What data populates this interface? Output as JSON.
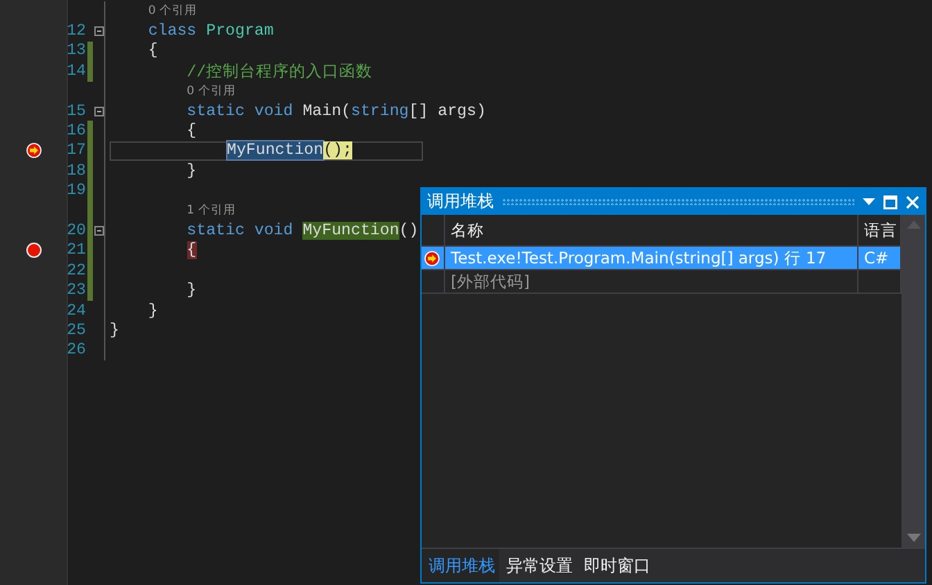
{
  "editor": {
    "lines": [
      {
        "kind": "lens",
        "text": "0 个引用",
        "changed": false
      },
      {
        "kind": "code",
        "number": "12",
        "foldable": true,
        "changed": false,
        "breakpoint": false,
        "current_statement": false,
        "current": false,
        "tokens": [
          {
            "text": "    class",
            "kind": "keyword"
          },
          {
            "text": " Program",
            "kind": "type"
          }
        ]
      },
      {
        "kind": "code",
        "number": "13",
        "foldable": false,
        "changed": true,
        "breakpoint": false,
        "current_statement": false,
        "current": false,
        "tokens": [
          {
            "text": "    {",
            "kind": "plain"
          }
        ]
      },
      {
        "kind": "code",
        "number": "14",
        "foldable": false,
        "changed": true,
        "breakpoint": false,
        "current_statement": false,
        "current": false,
        "tokens": [
          {
            "text": "        //控制台程序的入口函数",
            "kind": "comment"
          }
        ]
      },
      {
        "kind": "lens",
        "text": "0 个引用",
        "changed": false
      },
      {
        "kind": "code",
        "number": "15",
        "foldable": true,
        "changed": false,
        "breakpoint": false,
        "current_statement": false,
        "current": false,
        "tokens": [
          {
            "text": "        static",
            "kind": "keyword"
          },
          {
            "text": " void",
            "kind": "keyword"
          },
          {
            "text": " Main(",
            "kind": "plain"
          },
          {
            "text": "string",
            "kind": "keyword"
          },
          {
            "text": "[] args)",
            "kind": "plain"
          }
        ]
      },
      {
        "kind": "code",
        "number": "16",
        "foldable": false,
        "changed": true,
        "breakpoint": false,
        "current_statement": false,
        "current": false,
        "tokens": [
          {
            "text": "        {",
            "kind": "plain"
          }
        ]
      },
      {
        "kind": "code",
        "number": "17",
        "foldable": false,
        "changed": true,
        "breakpoint": false,
        "current_statement": true,
        "current": true,
        "tokens": [
          {
            "text": "            MyFunction",
            "kind": "selection"
          },
          {
            "text": "();",
            "kind": "statement"
          }
        ]
      },
      {
        "kind": "code",
        "number": "18",
        "foldable": false,
        "changed": true,
        "breakpoint": false,
        "current_statement": false,
        "current": false,
        "tokens": [
          {
            "text": "        }",
            "kind": "plain"
          }
        ]
      },
      {
        "kind": "code",
        "number": "19",
        "foldable": false,
        "changed": true,
        "breakpoint": false,
        "current_statement": false,
        "current": false
      },
      {
        "kind": "lens",
        "text": "1 个引用",
        "changed": true
      },
      {
        "kind": "code",
        "number": "20",
        "foldable": true,
        "changed": true,
        "breakpoint": false,
        "current_statement": false,
        "current": false,
        "tokens": [
          {
            "text": "        static",
            "kind": "keyword"
          },
          {
            "text": " void",
            "kind": "keyword"
          },
          {
            "text": " MyFunction",
            "kind": "reference"
          },
          {
            "text": "()",
            "kind": "plain"
          }
        ]
      },
      {
        "kind": "code",
        "number": "21",
        "foldable": false,
        "changed": true,
        "breakpoint": true,
        "current_statement": false,
        "current": false,
        "tokens": [
          {
            "text": "        {",
            "kind": "breakpoint"
          }
        ]
      },
      {
        "kind": "code",
        "number": "22",
        "foldable": false,
        "changed": true,
        "breakpoint": false,
        "current_statement": false,
        "current": false
      },
      {
        "kind": "code",
        "number": "23",
        "foldable": false,
        "changed": true,
        "breakpoint": false,
        "current_statement": false,
        "current": false,
        "tokens": [
          {
            "text": "        }",
            "kind": "plain"
          }
        ]
      },
      {
        "kind": "code",
        "number": "24",
        "foldable": false,
        "changed": false,
        "breakpoint": false,
        "current_statement": false,
        "current": false,
        "tokens": [
          {
            "text": "    }",
            "kind": "plain"
          }
        ]
      },
      {
        "kind": "code",
        "number": "25",
        "foldable": false,
        "changed": false,
        "breakpoint": false,
        "current_statement": false,
        "current": false,
        "tokens": [
          {
            "text": "}",
            "kind": "plain"
          }
        ]
      },
      {
        "kind": "code",
        "number": "26",
        "foldable": false,
        "changed": false,
        "breakpoint": false,
        "current_statement": false,
        "current": false
      }
    ]
  },
  "call_stack": {
    "title": "调用堆栈",
    "columns": [
      "名称",
      "语言"
    ],
    "rows": [
      {
        "name": "Test.exe!Test.Program.Main(string[] args) 行 17",
        "language": "C#",
        "selected": true,
        "current": true,
        "kind": "frame"
      },
      {
        "name": "[外部代码]",
        "selected": false,
        "current": false,
        "kind": "external"
      }
    ],
    "tabs": [
      {
        "label": "调用堆栈",
        "selected": true
      },
      {
        "label": "异常设置",
        "selected": false
      },
      {
        "label": "即时窗口",
        "selected": false
      }
    ]
  }
}
